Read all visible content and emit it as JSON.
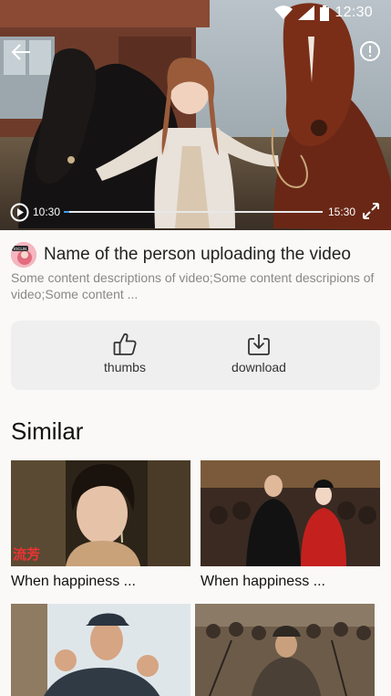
{
  "status_bar": {
    "time": "12:30"
  },
  "player": {
    "current_time": "10:30",
    "total_time": "15:30",
    "progress_fraction": 0.02
  },
  "video": {
    "uploader_name": "Name of the person uploading the video",
    "description": "Some content descriptions of video;Some content descripions of video;Some content ...",
    "avatar_badge": "IOCLIN"
  },
  "actions": [
    {
      "label": "thumbs",
      "icon": "thumbs-up-icon"
    },
    {
      "label": "download",
      "icon": "download-icon"
    }
  ],
  "similar": {
    "title": "Similar",
    "items": [
      {
        "title": "When happiness ...",
        "overlay": "流芳"
      },
      {
        "title": "When happiness ..."
      },
      {
        "title": ""
      },
      {
        "title": ""
      }
    ]
  },
  "colors": {
    "accent": "#3d9df0",
    "card_bg": "#efefef",
    "page_bg": "#faf9f7"
  }
}
